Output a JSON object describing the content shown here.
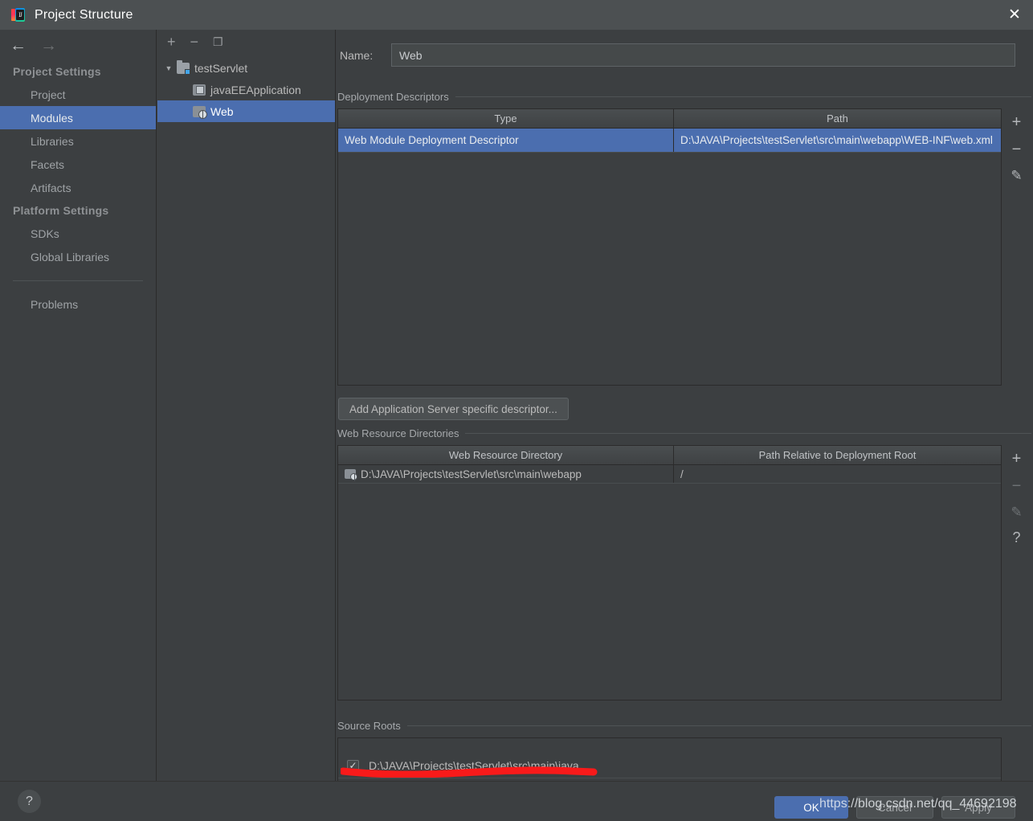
{
  "window": {
    "title": "Project Structure",
    "app_icon": "intellij-idea-icon",
    "close_label": "✕"
  },
  "sidebar": {
    "back_icon": "←",
    "forward_icon": "→",
    "groups": [
      {
        "label": "Project Settings",
        "items": [
          {
            "label": "Project",
            "selected": false
          },
          {
            "label": "Modules",
            "selected": true
          },
          {
            "label": "Libraries",
            "selected": false
          },
          {
            "label": "Facets",
            "selected": false
          },
          {
            "label": "Artifacts",
            "selected": false
          }
        ]
      },
      {
        "label": "Platform Settings",
        "items": [
          {
            "label": "SDKs",
            "selected": false
          },
          {
            "label": "Global Libraries",
            "selected": false
          }
        ]
      }
    ],
    "problems_label": "Problems"
  },
  "tree": {
    "toolbar": {
      "add": "+",
      "remove": "−",
      "copy": "❐"
    },
    "nodes": [
      {
        "label": "testServlet",
        "icon": "folder-module-icon",
        "twisty": "▼",
        "indent": 0,
        "selected": false
      },
      {
        "label": "javaEEApplication",
        "icon": "javaee-module-icon",
        "twisty": "",
        "indent": 1,
        "selected": false
      },
      {
        "label": "Web",
        "icon": "web-module-icon",
        "twisty": "",
        "indent": 1,
        "selected": true
      }
    ]
  },
  "content": {
    "name": {
      "label": "Name:",
      "value": "Web",
      "placeholder": ""
    },
    "deployment_descriptors": {
      "title": "Deployment Descriptors",
      "columns": [
        "Type",
        "Path"
      ],
      "rows": [
        {
          "type": "Web Module Deployment Descriptor",
          "path": "D:\\JAVA\\Projects\\testServlet\\src\\main\\webapp\\WEB-INF\\web.xml",
          "selected": true
        }
      ],
      "tools": [
        "+",
        "−",
        "pencil-icon"
      ],
      "add_button": "Add Application Server specific descriptor..."
    },
    "web_resource_directories": {
      "title": "Web Resource Directories",
      "columns": [
        "Web Resource Directory",
        "Path Relative to Deployment Root"
      ],
      "rows": [
        {
          "directory": "D:\\JAVA\\Projects\\testServlet\\src\\main\\webapp",
          "relative_path": "/",
          "icon": "web-folder-icon"
        }
      ],
      "tools": [
        "+",
        "−",
        "pencil-icon",
        "?"
      ]
    },
    "source_roots": {
      "title": "Source Roots",
      "rows": [
        {
          "path": "D:\\JAVA\\Projects\\testServlet\\src\\main\\java",
          "checked": true,
          "check_glyph": "✓"
        }
      ]
    }
  },
  "footer": {
    "help_label": "?",
    "ok_label": "OK",
    "cancel_label": "Cancel",
    "apply_label": "Apply"
  },
  "annotations": {
    "underline_color": "#f81a1a",
    "watermark_text": "https://blog.csdn.net/qq_44692198"
  }
}
